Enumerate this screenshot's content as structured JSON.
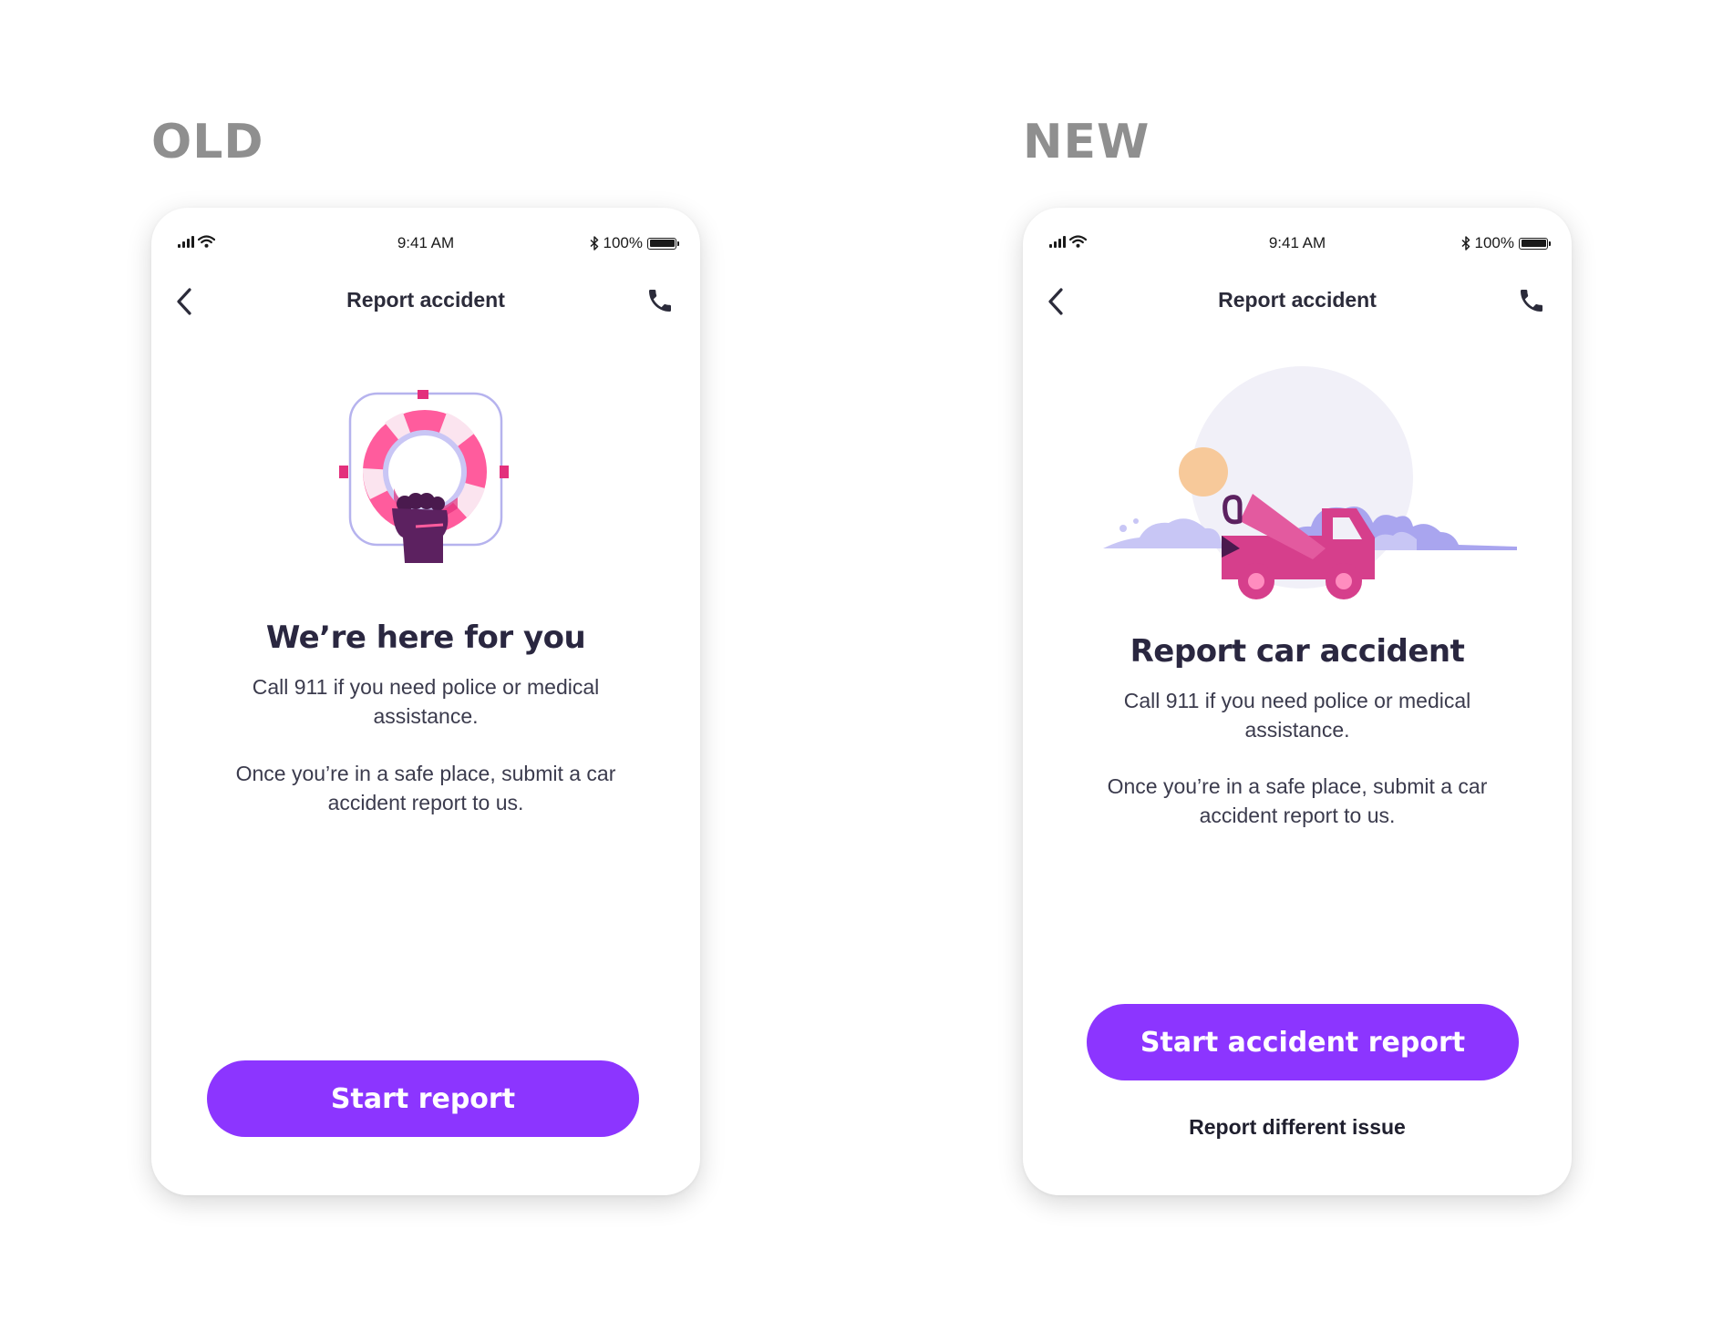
{
  "labels": {
    "old": "OLD",
    "new": "NEW"
  },
  "old_screen": {
    "status": {
      "time": "9:41 AM",
      "battery": "100%"
    },
    "nav": {
      "title": "Report accident",
      "back_icon": "chevron-left-icon",
      "call_icon": "phone-icon"
    },
    "illustration": "lifebuoy-in-hand-illustration",
    "heading": "We’re here for you",
    "paragraph_1": "Call 911 if you need police or medical assistance.",
    "paragraph_2": "Once you’re in a safe place, submit a car accident report to us.",
    "primary_button": "Start report"
  },
  "new_screen": {
    "status": {
      "time": "9:41 AM",
      "battery": "100%"
    },
    "nav": {
      "title": "Report accident",
      "back_icon": "chevron-left-icon",
      "call_icon": "phone-icon"
    },
    "illustration": "tow-truck-illustration",
    "heading": "Report car accident",
    "paragraph_1": "Call 911 if you need police or medical assistance.",
    "paragraph_2": "Once you’re in a safe place, submit a car accident report to us.",
    "primary_button": "Start accident report",
    "secondary_link": "Report different issue"
  },
  "colors": {
    "primary": "#8c35ff",
    "text_dark": "#2a2740",
    "label_gray": "#8f8f8f",
    "pink": "#ff5c9d",
    "magenta": "#d63f8c",
    "lavender": "#c5c4f5",
    "dark_purple": "#5c2160",
    "sun": "#f7c99a"
  }
}
